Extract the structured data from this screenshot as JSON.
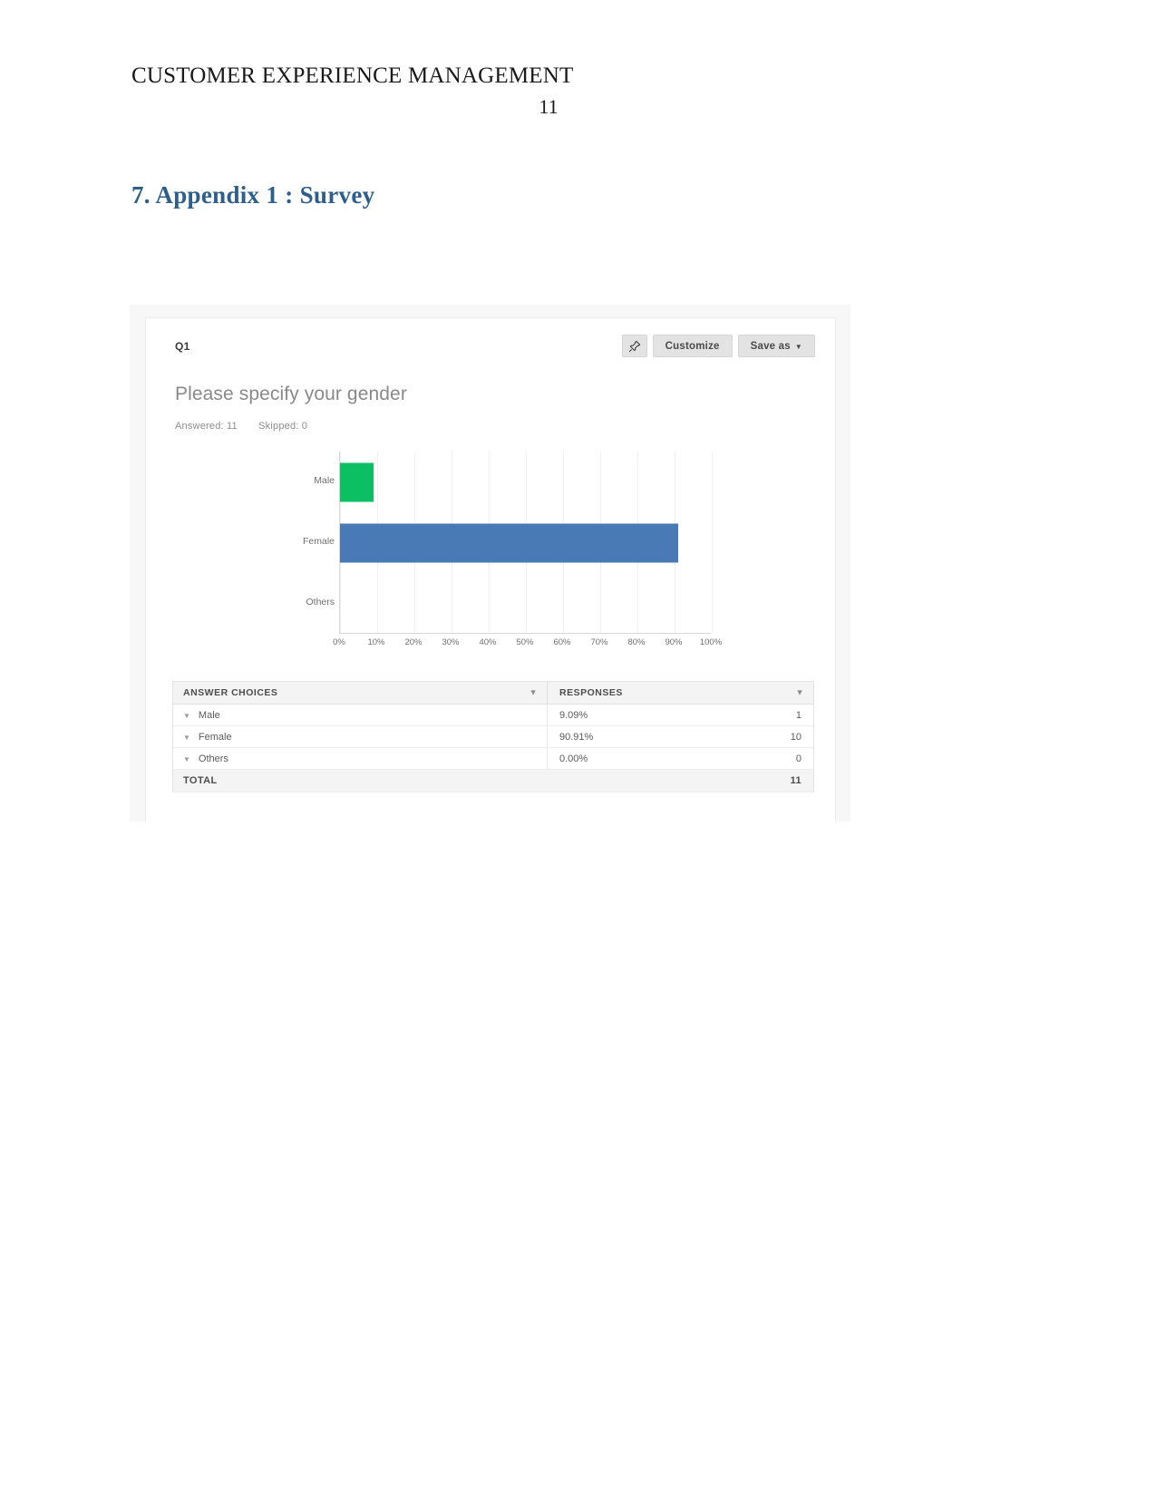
{
  "document": {
    "header_title": "CUSTOMER EXPERIENCE MANAGEMENT",
    "page_number": "11",
    "section_heading": "7. Appendix 1 : Survey"
  },
  "survey": {
    "question_number": "Q1",
    "question_text": "Please specify your gender",
    "answered_label": "Answered: 11",
    "skipped_label": "Skipped: 0",
    "actions": {
      "pin_icon": "pin-icon",
      "customize_label": "Customize",
      "save_as_label": "Save as",
      "save_as_caret": "▼"
    },
    "table": {
      "headers": {
        "choices": "ANSWER CHOICES",
        "responses": "RESPONSES"
      },
      "rows": [
        {
          "label": "Male",
          "percent": "9.09%",
          "count": "1"
        },
        {
          "label": "Female",
          "percent": "90.91%",
          "count": "10"
        },
        {
          "label": "Others",
          "percent": "0.00%",
          "count": "0"
        }
      ],
      "total_label": "TOTAL",
      "total_value": "11"
    }
  },
  "chart_data": {
    "type": "bar",
    "orientation": "horizontal",
    "title": "Please specify your gender",
    "categories": [
      "Male",
      "Female",
      "Others"
    ],
    "values": [
      9.09,
      90.91,
      0.0
    ],
    "counts": [
      1,
      10,
      0
    ],
    "colors": [
      "#0bbf62",
      "#4a7ab5",
      "#cccccc"
    ],
    "xlabel": "",
    "ylabel": "",
    "xlim": [
      0,
      100
    ],
    "xticks": [
      "0%",
      "10%",
      "20%",
      "30%",
      "40%",
      "50%",
      "60%",
      "70%",
      "80%",
      "90%",
      "100%"
    ],
    "xtick_values": [
      0,
      10,
      20,
      30,
      40,
      50,
      60,
      70,
      80,
      90,
      100
    ],
    "grid": true,
    "legend": "none"
  }
}
